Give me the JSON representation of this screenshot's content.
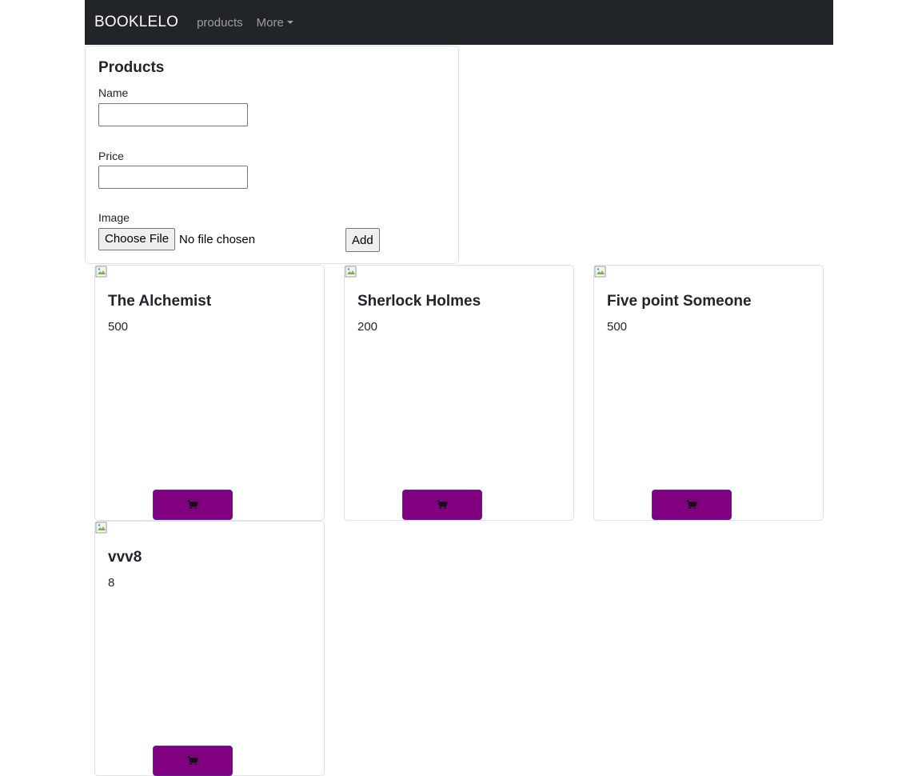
{
  "navbar": {
    "brand": "BOOKLELO",
    "links": [
      {
        "label": "products"
      },
      {
        "label": "More"
      }
    ]
  },
  "form": {
    "title": "Products",
    "name_label": "Name",
    "name_value": "",
    "price_label": "Price",
    "price_value": "",
    "image_label": "Image",
    "file_button": "Choose File",
    "file_status": "No file chosen",
    "add_button": "Add"
  },
  "products": [
    {
      "title": "The Alchemist",
      "price": "500"
    },
    {
      "title": "Sherlock Holmes",
      "price": "200"
    },
    {
      "title": "Five point Someone",
      "price": "500"
    },
    {
      "title": "vvv8",
      "price": "8"
    }
  ],
  "colors": {
    "navbar_bg": "#212529",
    "cart_button": "#800080"
  },
  "icons": {
    "cart": "cart-icon",
    "broken_image": "broken-image-icon",
    "dropdown": "caret-down-icon"
  }
}
